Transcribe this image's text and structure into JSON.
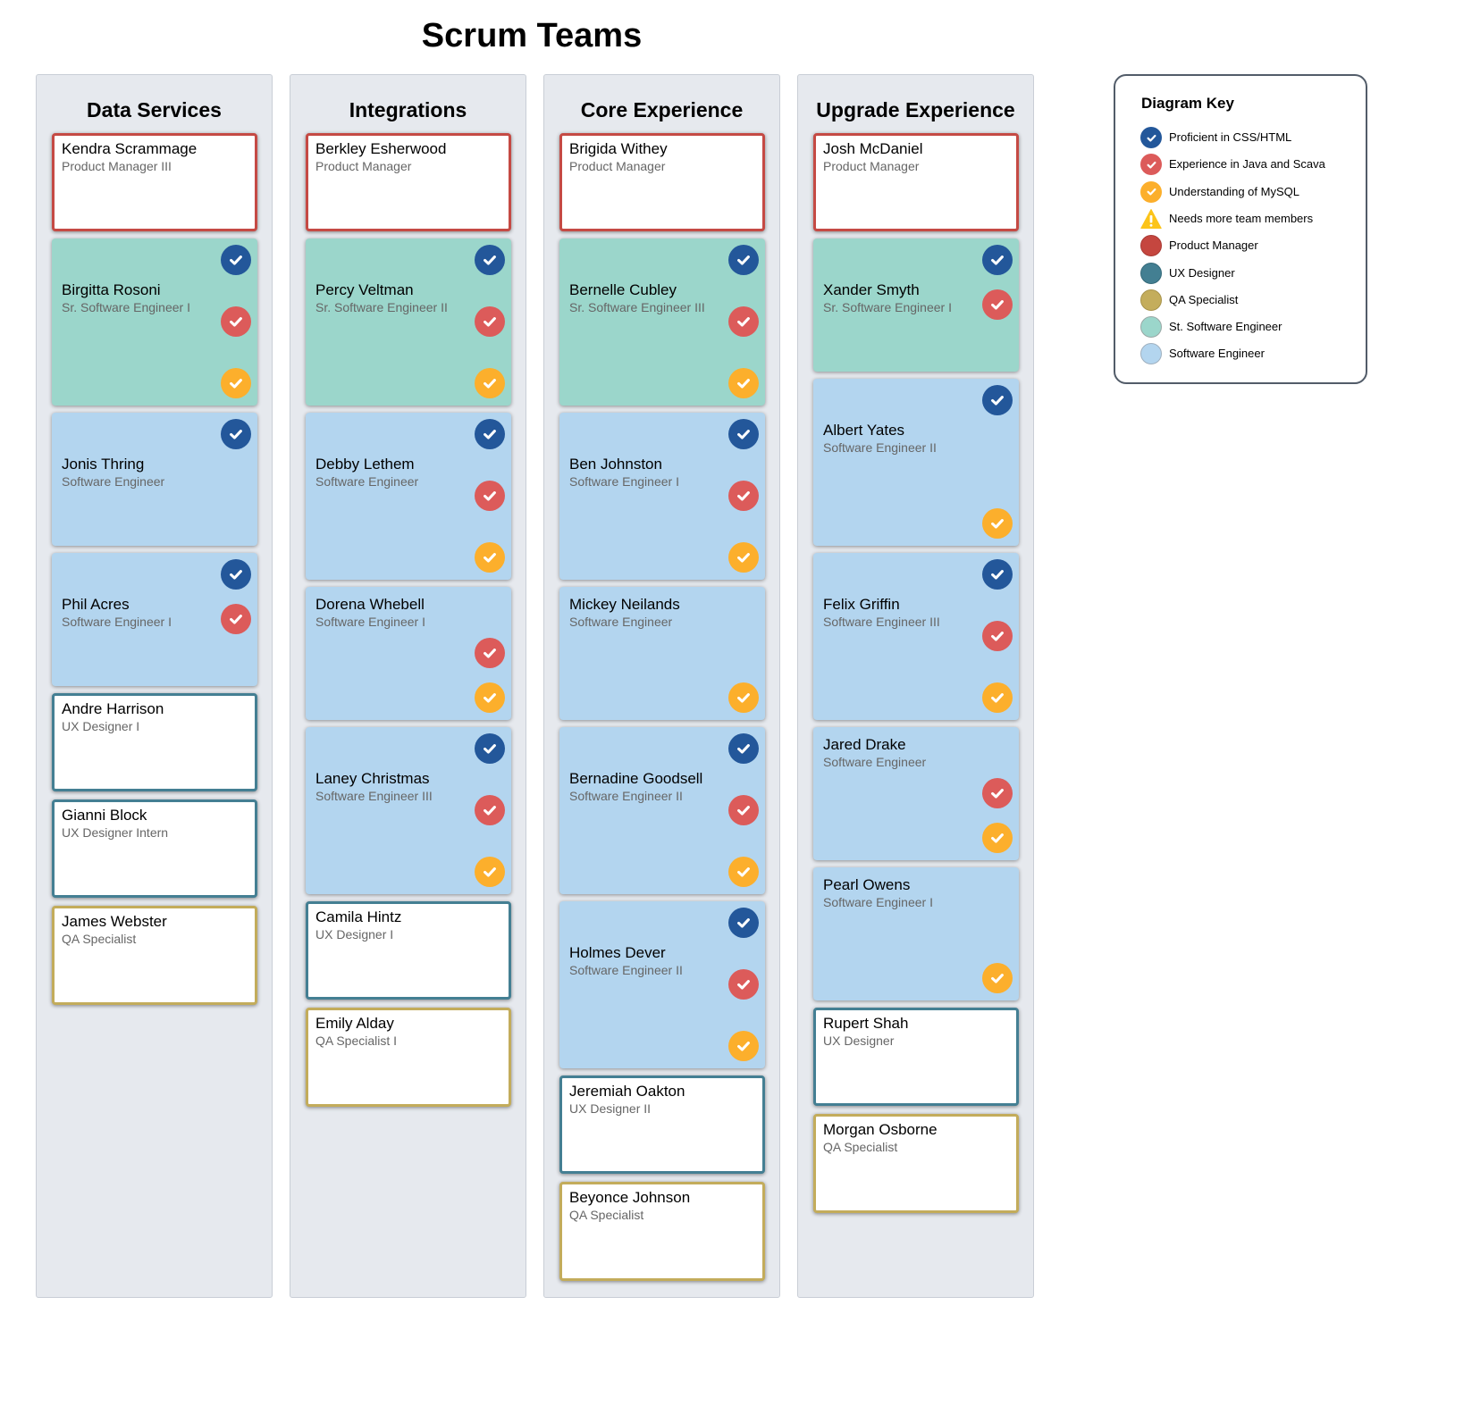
{
  "title": "Scrum Teams",
  "colors": {
    "product_manager": "#c54a44",
    "ux_designer": "#447f93",
    "qa_specialist": "#c3ac5b",
    "sr_software_engineer": "#9bd6cb",
    "software_engineer": "#b3d5ef",
    "css_html": "#23579a",
    "java_scava": "#dc5b5a",
    "mysql": "#fcaf2c",
    "warning": "#fcc419",
    "column_bg": "#e6e9ee"
  },
  "columns": [
    {
      "title": "Data Services",
      "members": [
        {
          "name": "Kendra Scrammage",
          "role": "Product Manager III",
          "type": "pm",
          "skills": []
        },
        {
          "name": "Birgitta Rosoni",
          "role": "Sr. Software Engineer I",
          "type": "sr",
          "skills": [
            "css",
            "java",
            "mysql"
          ]
        },
        {
          "name": "Jonis Thring",
          "role": "Software Engineer",
          "type": "se",
          "skills": [
            "css"
          ]
        },
        {
          "name": "Phil Acres",
          "role": "Software Engineer I",
          "type": "se",
          "skills": [
            "css",
            "java"
          ]
        },
        {
          "name": "Andre Harrison",
          "role": "UX Designer I",
          "type": "ux",
          "skills": []
        },
        {
          "name": "Gianni Block",
          "role": "UX Designer Intern",
          "type": "ux",
          "skills": []
        },
        {
          "name": "James Webster",
          "role": "QA Specialist",
          "type": "qa",
          "skills": []
        }
      ]
    },
    {
      "title": "Integrations",
      "members": [
        {
          "name": "Berkley Esherwood",
          "role": "Product Manager",
          "type": "pm",
          "skills": []
        },
        {
          "name": "Percy Veltman",
          "role": "Sr. Software Engineer II",
          "type": "sr",
          "skills": [
            "css",
            "java",
            "mysql"
          ]
        },
        {
          "name": "Debby Lethem",
          "role": "Software Engineer",
          "type": "se",
          "skills": [
            "css",
            "java",
            "mysql"
          ]
        },
        {
          "name": "Dorena Whebell",
          "role": "Software Engineer I",
          "type": "se",
          "skills": [
            "java",
            "mysql"
          ]
        },
        {
          "name": "Laney Christmas",
          "role": "Software Engineer III",
          "type": "se",
          "skills": [
            "css",
            "java",
            "mysql"
          ]
        },
        {
          "name": "Camila Hintz",
          "role": "UX Designer I",
          "type": "ux",
          "skills": []
        },
        {
          "name": "Emily Alday",
          "role": "QA Specialist I",
          "type": "qa",
          "skills": []
        }
      ]
    },
    {
      "title": "Core Experience",
      "members": [
        {
          "name": "Brigida Withey",
          "role": "Product Manager",
          "type": "pm",
          "skills": []
        },
        {
          "name": "Bernelle Cubley",
          "role": "Sr. Software Engineer III",
          "type": "sr",
          "skills": [
            "css",
            "java",
            "mysql"
          ]
        },
        {
          "name": "Ben Johnston",
          "role": "Software Engineer I",
          "type": "se",
          "skills": [
            "css",
            "java",
            "mysql"
          ]
        },
        {
          "name": "Mickey Neilands",
          "role": "Software Engineer",
          "type": "se",
          "skills": [
            "mysql"
          ]
        },
        {
          "name": "Bernadine Goodsell",
          "role": "Software Engineer II",
          "type": "se",
          "skills": [
            "css",
            "java",
            "mysql"
          ]
        },
        {
          "name": "Holmes Dever",
          "role": "Software Engineer II",
          "type": "se",
          "skills": [
            "css",
            "java",
            "mysql"
          ]
        },
        {
          "name": "Jeremiah Oakton",
          "role": "UX Designer II",
          "type": "ux",
          "skills": []
        },
        {
          "name": "Beyonce Johnson",
          "role": "QA Specialist",
          "type": "qa",
          "skills": []
        }
      ]
    },
    {
      "title": "Upgrade Experience",
      "members": [
        {
          "name": "Josh McDaniel",
          "role": "Product Manager",
          "type": "pm",
          "skills": []
        },
        {
          "name": "Xander Smyth",
          "role": "Sr. Software Engineer I",
          "type": "sr",
          "skills": [
            "css",
            "java"
          ]
        },
        {
          "name": "Albert Yates",
          "role": "Software Engineer II",
          "type": "se",
          "skills": [
            "css",
            "mysql"
          ]
        },
        {
          "name": "Felix Griffin",
          "role": "Software Engineer III",
          "type": "se",
          "skills": [
            "css",
            "java",
            "mysql"
          ]
        },
        {
          "name": "Jared Drake",
          "role": "Software Engineer",
          "type": "se",
          "skills": [
            "java",
            "mysql"
          ]
        },
        {
          "name": "Pearl Owens",
          "role": "Software Engineer I",
          "type": "se",
          "skills": [
            "mysql"
          ]
        },
        {
          "name": "Rupert Shah",
          "role": "UX Designer",
          "type": "ux",
          "skills": []
        },
        {
          "name": "Morgan Osborne",
          "role": "QA Specialist",
          "type": "qa",
          "skills": []
        }
      ]
    }
  ],
  "legend": {
    "title": "Diagram Key",
    "items": [
      {
        "key": "css",
        "icon": "check-circle-icon",
        "label": "Proficient in CSS/HTML"
      },
      {
        "key": "java",
        "icon": "check-circle-icon",
        "label": "Experience in Java and Scava"
      },
      {
        "key": "mysql",
        "icon": "check-circle-icon",
        "label": "Understanding of MySQL"
      },
      {
        "key": "warn",
        "icon": "warning-icon",
        "label": "Needs more team members"
      },
      {
        "key": "pm",
        "icon": "circle-swatch",
        "label": "Product Manager"
      },
      {
        "key": "ux",
        "icon": "circle-swatch",
        "label": "UX Designer"
      },
      {
        "key": "qa",
        "icon": "circle-swatch",
        "label": "QA Specialist"
      },
      {
        "key": "sr",
        "icon": "circle-swatch",
        "label": "St. Software Engineer"
      },
      {
        "key": "se",
        "icon": "circle-swatch",
        "label": "Software Engineer"
      }
    ]
  }
}
